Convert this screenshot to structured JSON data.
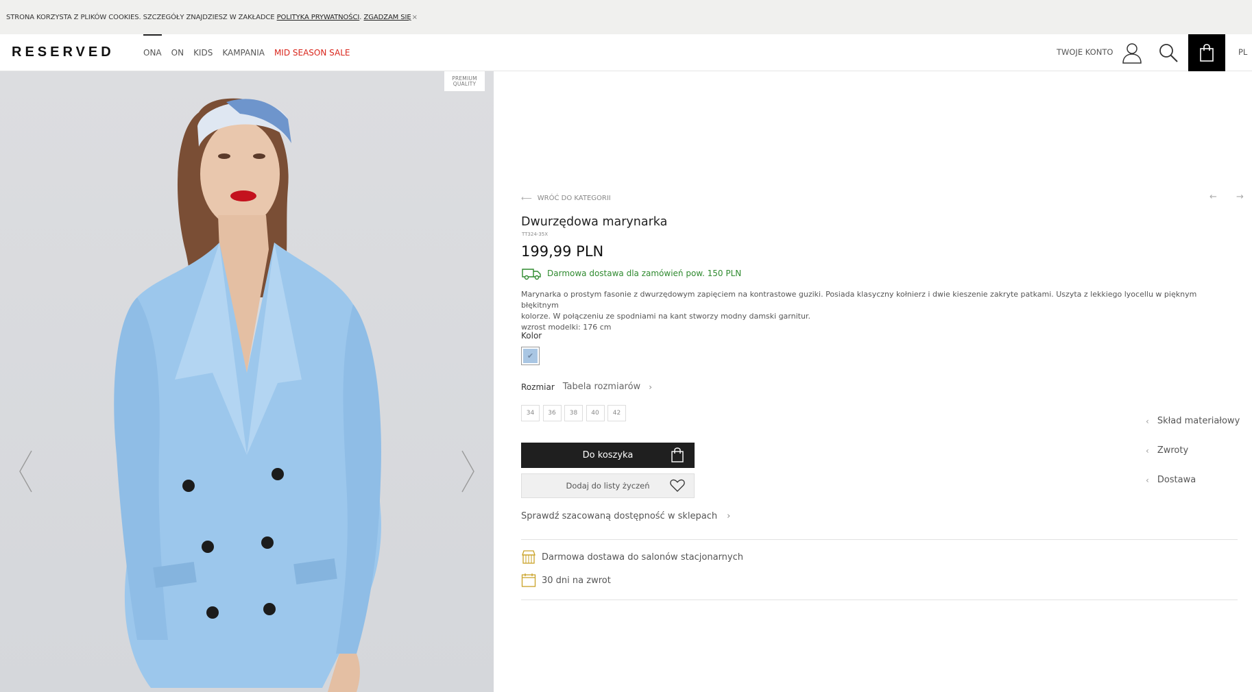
{
  "cookie_bar": {
    "text": "STRONA KORZYSTA Z PLIKÓW COOKIES. SZCZEGÓŁY ZNAJDZIESZ W ZAKŁADCE",
    "privacy_link": "POLITYKA PRYWATNOŚCI",
    "separator": ".",
    "accept_link": "ZGADZAM SIĘ",
    "close": "×"
  },
  "header": {
    "logo": "RESERVED",
    "nav": [
      {
        "label": "ONA",
        "active": true
      },
      {
        "label": "ON"
      },
      {
        "label": "KIDS"
      },
      {
        "label": "KAMPANIA"
      },
      {
        "label": "MID SEASON SALE",
        "sale": true
      }
    ],
    "account_label": "TWOJE KONTO",
    "lang": "PL"
  },
  "image": {
    "badge_line1": "PREMIUM",
    "badge_line2": "QUALITY"
  },
  "product": {
    "back_link": "WRÓĆ DO KATEGORII",
    "back_arrow": "⟵",
    "prevnext": "← →",
    "title": "Dwurzędowa marynarka",
    "sku": "TT324-35X",
    "price": "199,99 PLN",
    "free_delivery": "Darmowa dostawa dla zamówień pow. 150 PLN",
    "description_line1": "Marynarka o prostym fasonie z dwurzędowym zapięciem na kontrastowe guziki. Posiada klasyczny kołnierz i dwie kieszenie zakryte patkami. Uszyta z lekkiego lyocellu w pięknym błękitnym",
    "description_line2": "kolorze. W połączeniu ze spodniami na kant stworzy modny damski garnitur.",
    "description_line3": "wzrost modelki: 176 cm",
    "color_label": "Kolor",
    "color_swatch": "#a9c6e3",
    "swatch_check": "✔",
    "size_label": "Rozmiar",
    "size_chart_label": "Tabela rozmiarów",
    "chevron": "›",
    "sizes": [
      "34",
      "36",
      "38",
      "40",
      "42"
    ],
    "add_to_cart": "Do koszyka",
    "add_to_wishlist": "Dodaj do listy życzeń",
    "store_availability": "Sprawdź szacowaną dostępność w sklepach",
    "perk_store_delivery": "Darmowa dostawa do salonów stacjonarnych",
    "perk_returns": "30 dni na zwrot",
    "accordion_chevron": "‹",
    "accordion": [
      "Skład materiałowy",
      "Zwroty",
      "Dostawa"
    ]
  }
}
